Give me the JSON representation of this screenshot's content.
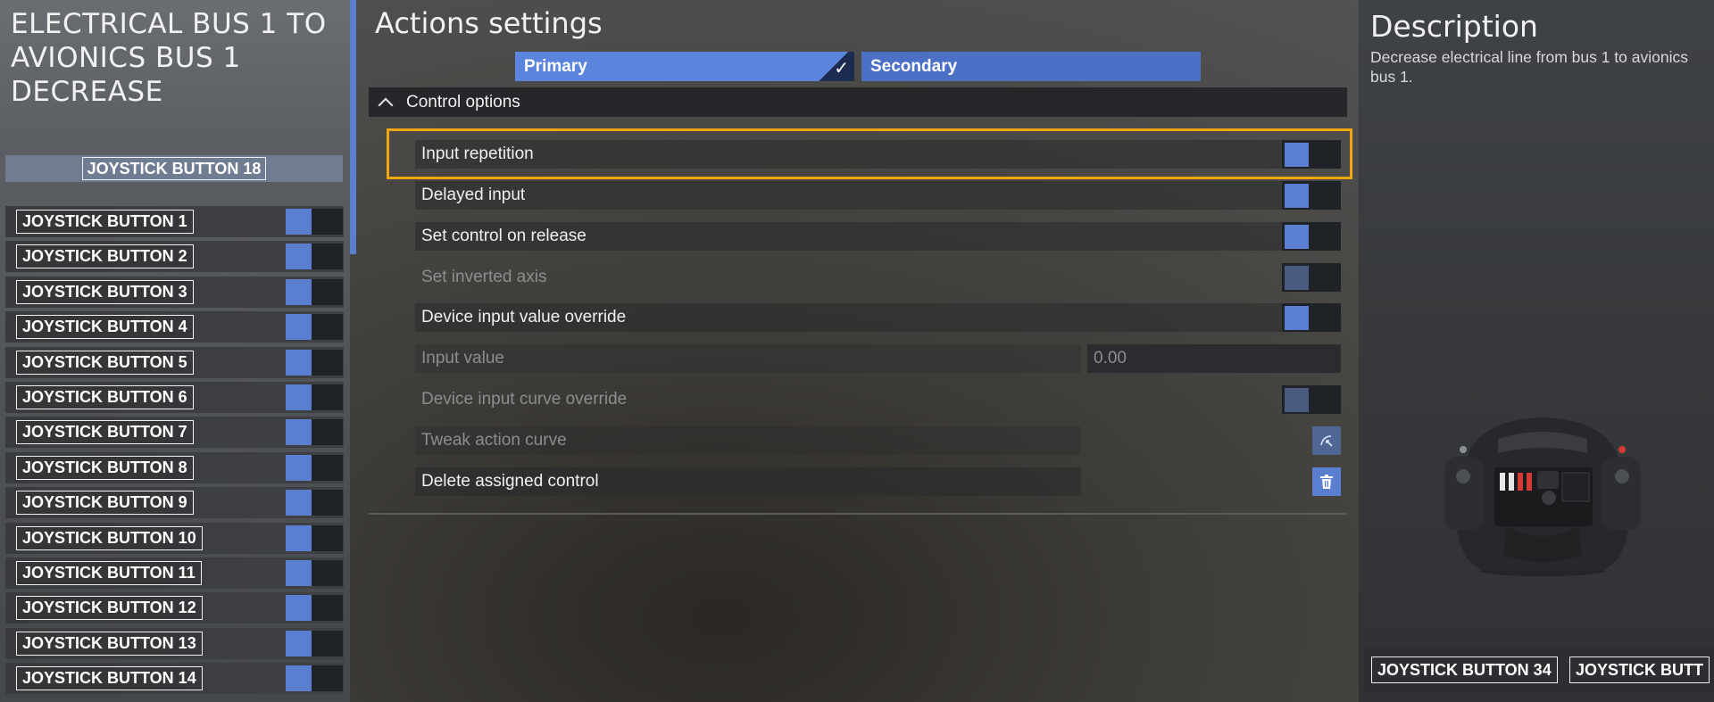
{
  "left": {
    "action_title": "ELECTRICAL BUS 1 TO AVIONICS BUS 1 DECREASE",
    "current_binding": "JOYSTICK BUTTON 18",
    "bindings": [
      {
        "label": "JOYSTICK BUTTON 1"
      },
      {
        "label": "JOYSTICK BUTTON 2"
      },
      {
        "label": "JOYSTICK BUTTON 3"
      },
      {
        "label": "JOYSTICK BUTTON 4"
      },
      {
        "label": "JOYSTICK BUTTON 5"
      },
      {
        "label": "JOYSTICK BUTTON 6"
      },
      {
        "label": "JOYSTICK BUTTON 7"
      },
      {
        "label": "JOYSTICK BUTTON 8"
      },
      {
        "label": "JOYSTICK BUTTON 9"
      },
      {
        "label": "JOYSTICK BUTTON 10"
      },
      {
        "label": "JOYSTICK BUTTON 11"
      },
      {
        "label": "JOYSTICK BUTTON 12"
      },
      {
        "label": "JOYSTICK BUTTON 13"
      },
      {
        "label": "JOYSTICK BUTTON 14"
      }
    ]
  },
  "center": {
    "title": "Actions settings",
    "tabs": {
      "primary": "Primary",
      "secondary": "Secondary",
      "check_icon": "checkmark-icon"
    },
    "section": {
      "label": "Control options",
      "icon": "chevron-up-icon"
    },
    "options": [
      {
        "label": "Input repetition",
        "enabled": true,
        "control": "toggle"
      },
      {
        "label": "Delayed input",
        "enabled": true,
        "control": "toggle"
      },
      {
        "label": "Set control on release",
        "enabled": true,
        "control": "toggle"
      },
      {
        "label": "Set inverted axis",
        "enabled": false,
        "control": "toggle"
      },
      {
        "label": "Device input value override",
        "enabled": true,
        "control": "toggle"
      },
      {
        "label": "Input value",
        "enabled": false,
        "control": "value",
        "value": "0.00"
      },
      {
        "label": "Device input curve override",
        "enabled": false,
        "control": "toggle"
      },
      {
        "label": "Tweak action curve",
        "enabled": false,
        "control": "button",
        "icon": "curve-icon"
      },
      {
        "label": "Delete assigned control",
        "enabled": true,
        "control": "button",
        "icon": "trash-icon"
      }
    ],
    "accent_color": "#5b84dc",
    "highlight_color": "#f1a50f"
  },
  "right": {
    "title": "Description",
    "text": "Decrease electrical line from bus 1 to avionics bus 1.",
    "device_icon": "yoke-controller-image",
    "bindings": [
      "JOYSTICK BUTTON 34",
      "JOYSTICK BUTT"
    ]
  }
}
